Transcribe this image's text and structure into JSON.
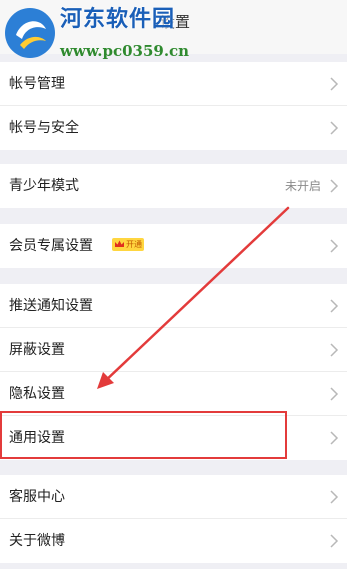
{
  "header": {
    "back_icon": "back-arrow-icon",
    "title": "设置"
  },
  "watermark": {
    "title": "河东软件园",
    "url": "www.pc0359.cn"
  },
  "groups": [
    {
      "items": [
        {
          "label": "帐号管理"
        },
        {
          "label": "帐号与安全"
        }
      ]
    },
    {
      "items": [
        {
          "label": "青少年模式",
          "value": "未开启"
        }
      ]
    },
    {
      "items": [
        {
          "label": "会员专属设置",
          "badge": "开通"
        }
      ]
    },
    {
      "items": [
        {
          "label": "推送通知设置"
        },
        {
          "label": "屏蔽设置"
        },
        {
          "label": "隐私设置"
        },
        {
          "label": "通用设置"
        }
      ]
    },
    {
      "items": [
        {
          "label": "客服中心"
        },
        {
          "label": "关于微博"
        }
      ]
    }
  ],
  "colors": {
    "annotation": "#e33b3b",
    "background": "#efeff4",
    "watermark_title": "#1a5fb8",
    "watermark_url": "#2f8a2f"
  }
}
